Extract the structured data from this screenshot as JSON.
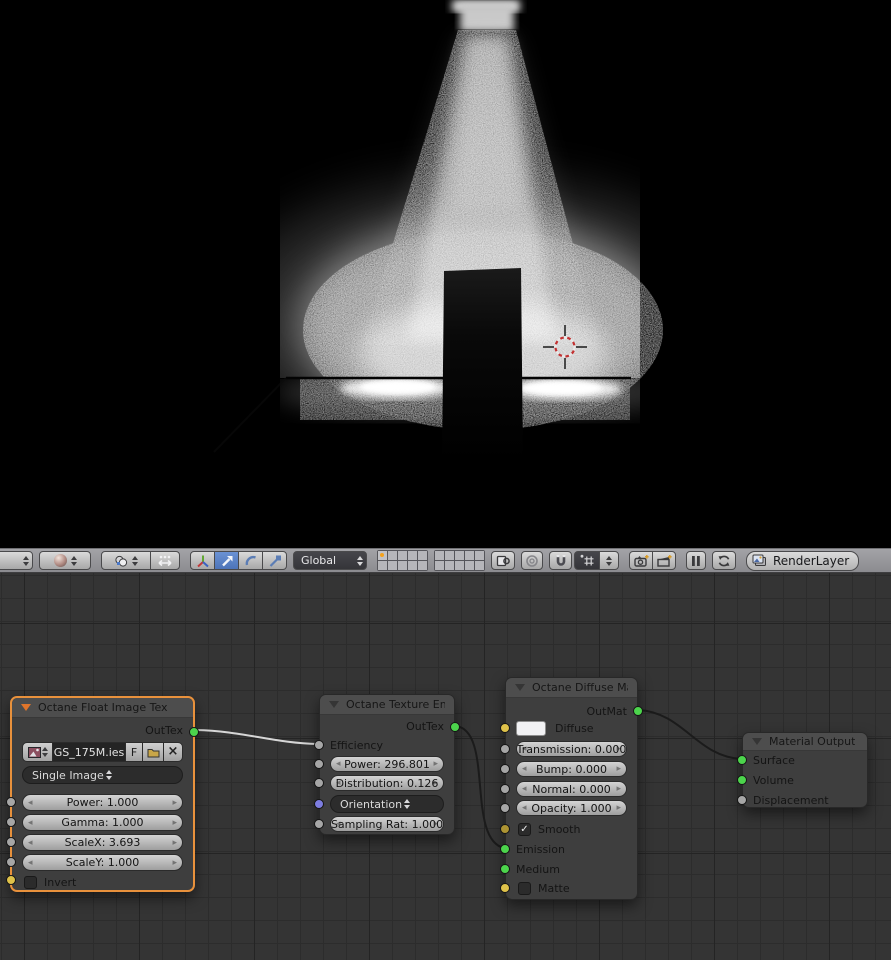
{
  "toolbar": {
    "orientation_value": "Global",
    "render_layer_label": "RenderLayer",
    "icons": [
      "editor-type-arrows",
      "viewport-shading-sphere",
      "pivot-point",
      "manipulator-toggle",
      "axis-manipulator",
      "translate-manipulator",
      "rotate-manipulator",
      "scale-manipulator",
      "layers-grid",
      "scene-lock",
      "proportional-edit",
      "snap-magnet",
      "snap-element",
      "opengl-render-image",
      "opengl-render-anim",
      "pause",
      "refresh",
      "render-layer-stack"
    ]
  },
  "glyphs": {
    "check": "✓"
  },
  "nodes": {
    "float_image_tex": {
      "title": "Octane Float Image Tex",
      "output_label": "OutTex",
      "image_name": "GS_175M.ies",
      "fake_user_label": "F",
      "source_value": "Single Image",
      "power": "Power: 1.000",
      "gamma": "Gamma: 1.000",
      "scale_x": "ScaleX: 3.693",
      "scale_y": "ScaleY: 1.000",
      "invert_label": "Invert"
    },
    "texture_emission": {
      "title": "Octane Texture Emissi",
      "output_label": "OutTex",
      "efficiency_label": "Efficiency",
      "power": "Power: 296.801",
      "distribution": "Distribution: 0.126",
      "orientation_value": "Orientation",
      "sampling_rate": "Sampling Rat: 1.000"
    },
    "diffuse_mat": {
      "title": "Octane Diffuse Mat",
      "output_label": "OutMat",
      "diffuse_label": "Diffuse",
      "transmission": "Transmission: 0.000",
      "bump": "Bump: 0.000",
      "normal": "Normal: 0.000",
      "opacity": "Opacity: 1.000",
      "smooth_label": "Smooth",
      "emission_label": "Emission",
      "medium_label": "Medium",
      "matte_label": "Matte"
    },
    "material_output": {
      "title": "Material Output",
      "surface_label": "Surface",
      "volume_label": "Volume",
      "displacement_label": "Displacement"
    }
  },
  "colors": {
    "active_node_outline": "#e8913c",
    "selected_tool_blue": "#5a81c4",
    "socket_green": "#4cd44c",
    "socket_gray": "#a6a6a6",
    "socket_yellow": "#dfc24a",
    "socket_olive": "#ad9433",
    "socket_purple": "#7d7de0",
    "cursor_red": "#c23030",
    "layer_active_dot": "#f5a21b"
  }
}
